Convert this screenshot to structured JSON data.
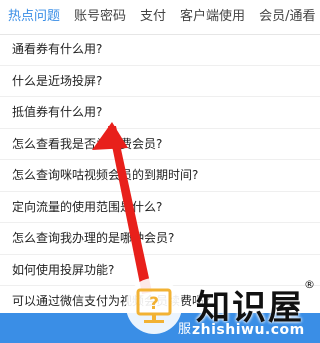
{
  "tabs": [
    "热点问题",
    "账号密码",
    "支付",
    "客户端使用",
    "会员/通看"
  ],
  "faq": [
    "通看券有什么用?",
    "什么是近场投屏?",
    "抵值券有什么用?",
    "怎么查看我是否为续费会员?",
    "怎么查询咪咕视频会员的到期时间?",
    "定向流量的使用范围是什么?",
    "怎么查询我办理的是哪种会员?",
    "如何使用投屏功能?",
    "可以通过微信支付为视频会员续费吗?"
  ],
  "bottom": {
    "label": "服"
  },
  "icons": {
    "help": "help-monitor-icon",
    "arrow": "red-arrow-annotation"
  },
  "colors": {
    "accent": "#3a8ee6",
    "arrow": "#e8201b"
  },
  "watermark": {
    "logo": "知识屋",
    "reg": "®",
    "url": "zhishiwu.com"
  }
}
